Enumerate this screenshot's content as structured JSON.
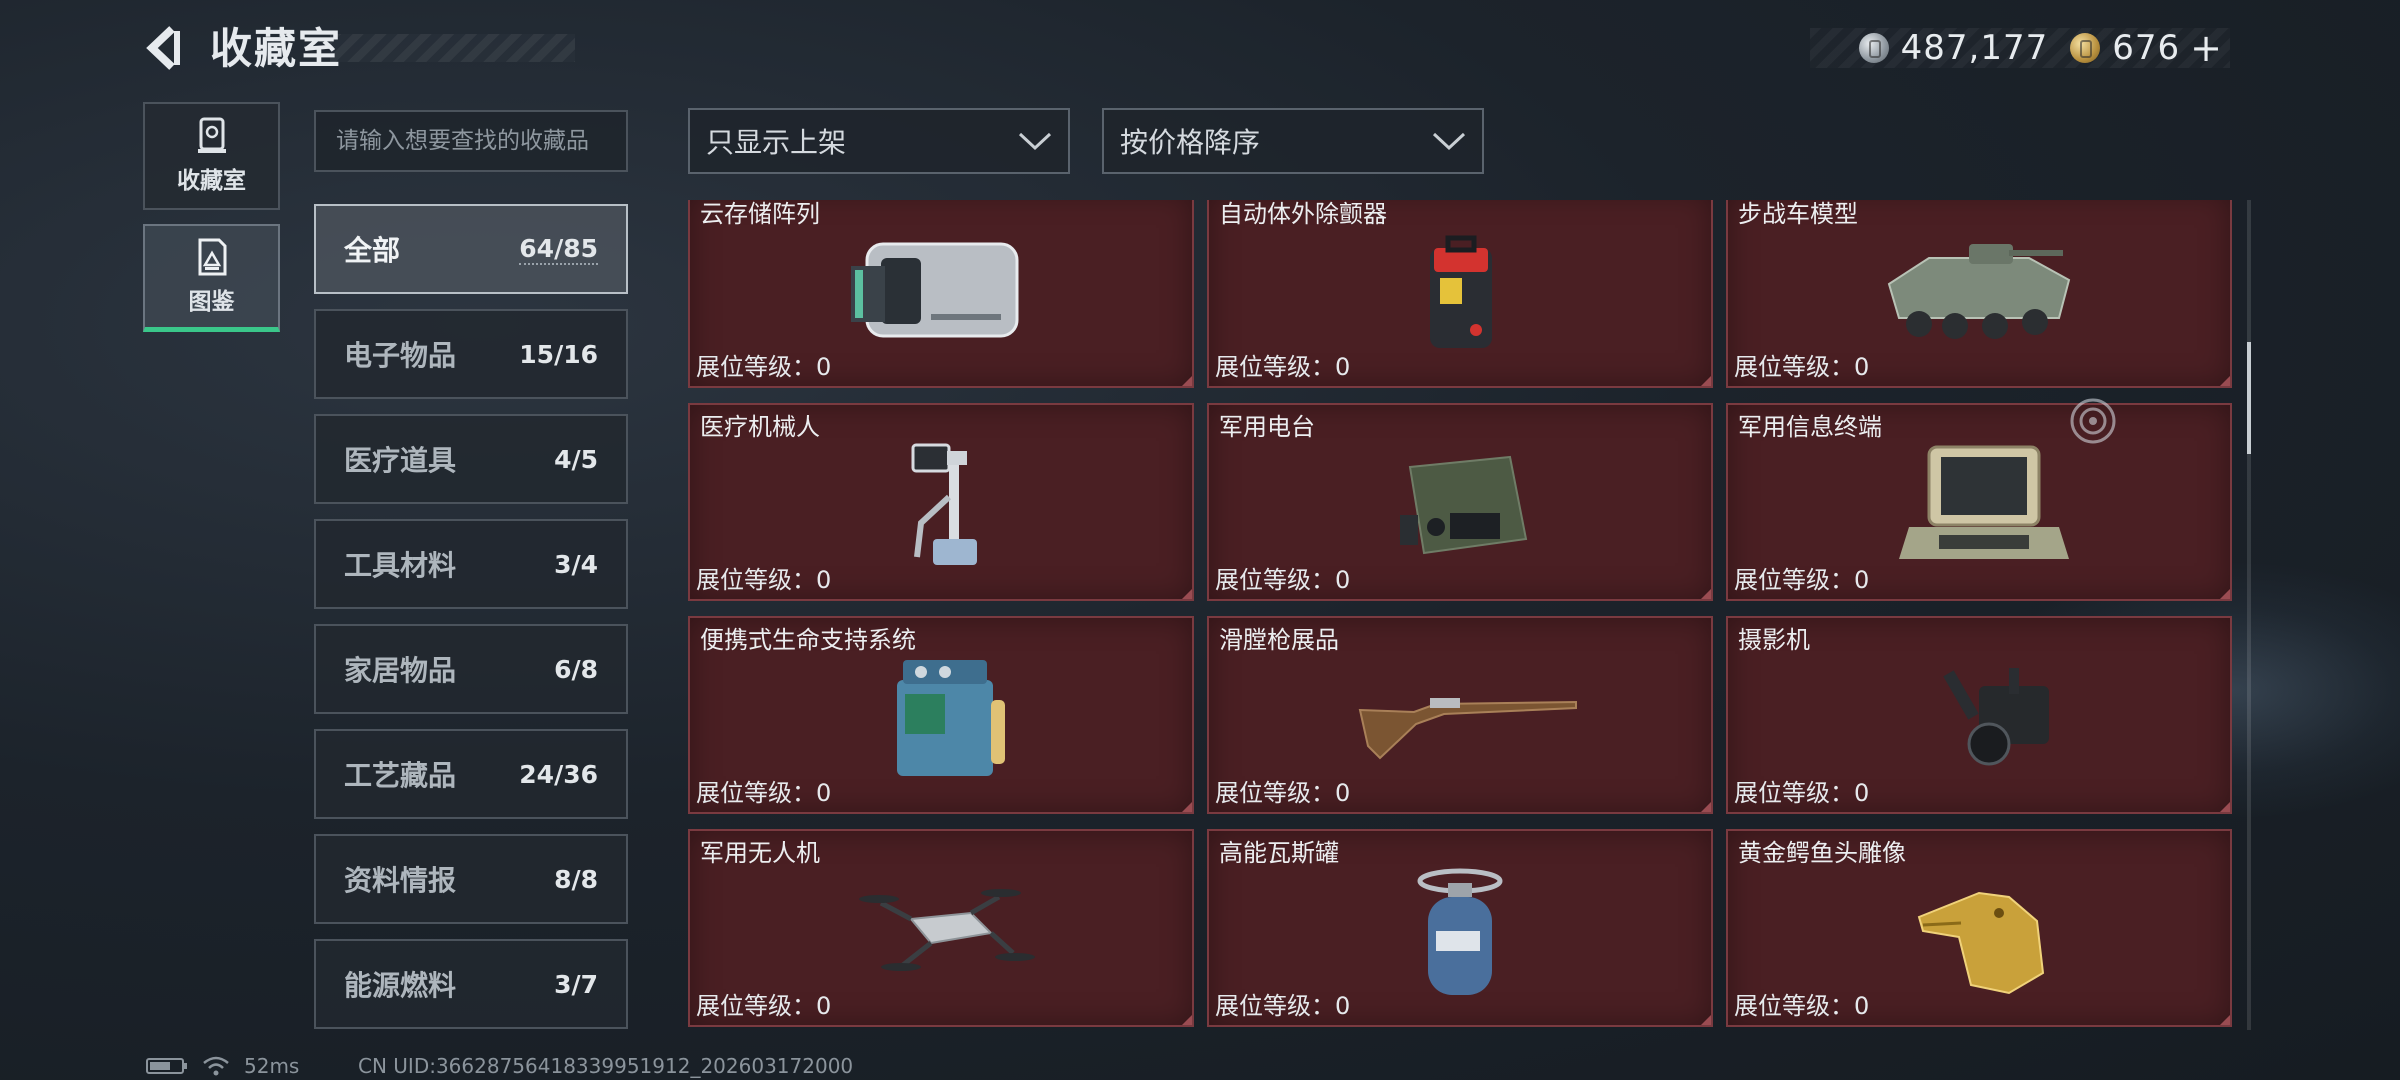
{
  "header": {
    "title": "收藏室",
    "currencies": [
      {
        "icon": "silver-coin-icon",
        "value": "487,177"
      },
      {
        "icon": "gold-coin-icon",
        "value": "676"
      }
    ],
    "add_label": "+"
  },
  "side_tabs": [
    {
      "label": "收藏室",
      "icon": "collection-room-icon",
      "active": false
    },
    {
      "label": "图鉴",
      "icon": "catalog-icon",
      "active": true
    }
  ],
  "search": {
    "placeholder": "请输入想要查找的收藏品"
  },
  "filters": {
    "display": {
      "value": "只显示上架"
    },
    "sort": {
      "value": "按价格降序"
    }
  },
  "categories": [
    {
      "name": "全部",
      "count": "64/85",
      "active": true
    },
    {
      "name": "电子物品",
      "count": "15/16"
    },
    {
      "name": "医疗道具",
      "count": "4/5"
    },
    {
      "name": "工具材料",
      "count": "3/4"
    },
    {
      "name": "家居物品",
      "count": "6/8"
    },
    {
      "name": "工艺藏品",
      "count": "24/36"
    },
    {
      "name": "资料情报",
      "count": "8/8"
    },
    {
      "name": "能源燃料",
      "count": "3/7"
    }
  ],
  "items": [
    {
      "name": "云存储阵列",
      "level": "展位等级：0",
      "icon": "storage-array-icon"
    },
    {
      "name": "自动体外除颤器",
      "level": "展位等级：0",
      "icon": "defibrillator-icon"
    },
    {
      "name": "步战车模型",
      "level": "展位等级：0",
      "icon": "armored-vehicle-icon"
    },
    {
      "name": "医疗机械人",
      "level": "展位等级：0",
      "icon": "medical-robot-icon"
    },
    {
      "name": "军用电台",
      "level": "展位等级：0",
      "icon": "military-radio-icon"
    },
    {
      "name": "军用信息终端",
      "level": "展位等级：0",
      "icon": "info-terminal-icon"
    },
    {
      "name": "便携式生命支持系统",
      "level": "展位等级：0",
      "icon": "life-support-icon"
    },
    {
      "name": "滑膛枪展品",
      "level": "展位等级：0",
      "icon": "musket-icon"
    },
    {
      "name": "摄影机",
      "level": "展位等级：0",
      "icon": "camera-icon"
    },
    {
      "name": "军用无人机",
      "level": "展位等级：0",
      "icon": "drone-icon"
    },
    {
      "name": "高能瓦斯罐",
      "level": "展位等级：0",
      "icon": "gas-tank-icon"
    },
    {
      "name": "黄金鳄鱼头雕像",
      "level": "展位等级：0",
      "icon": "gold-crocodile-icon"
    }
  ],
  "status": {
    "ping": "52ms",
    "uid": "CN UID:36628756418339951912_202603172000"
  }
}
